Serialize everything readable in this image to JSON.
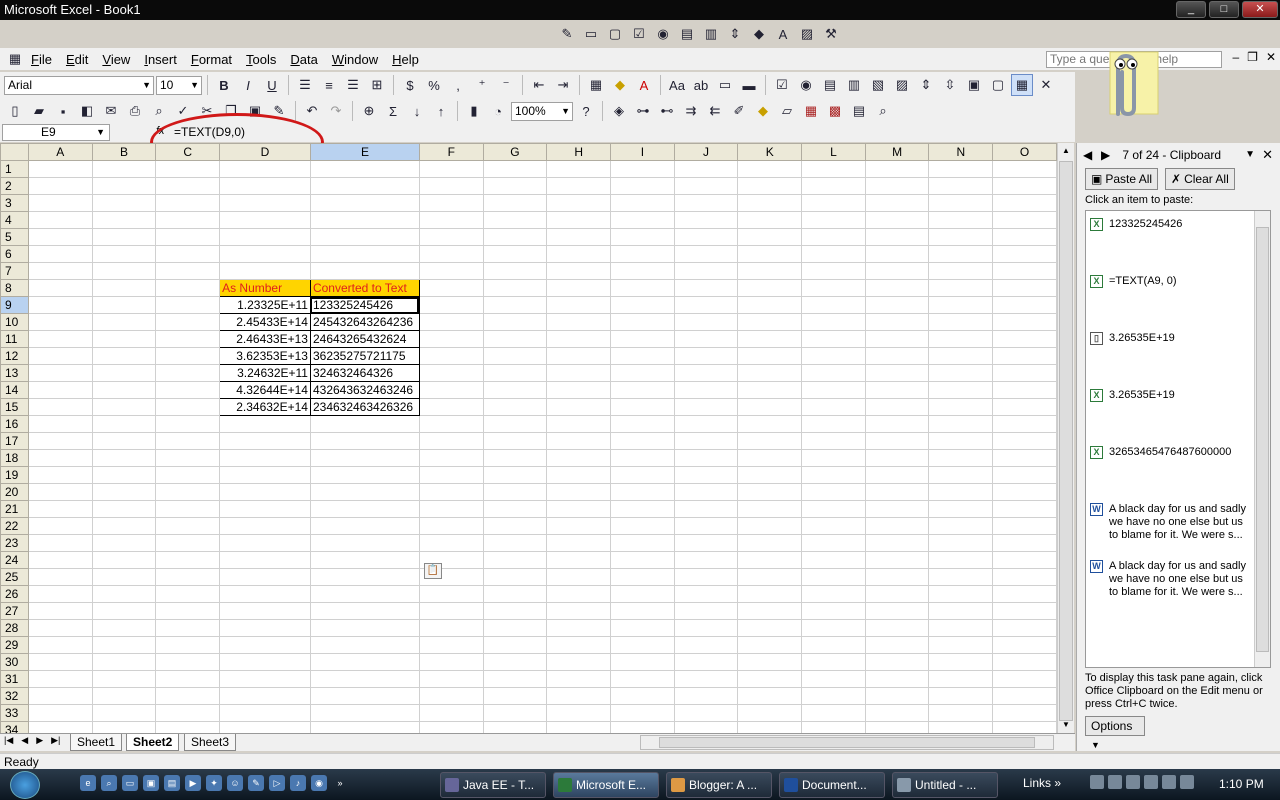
{
  "window": {
    "title": "Microsoft Excel - Book1",
    "min": "_",
    "max": "□",
    "close": "✕"
  },
  "menu": {
    "items": [
      {
        "key": "F",
        "rest": "ile"
      },
      {
        "key": "E",
        "rest": "dit"
      },
      {
        "key": "V",
        "rest": "iew"
      },
      {
        "key": "I",
        "rest": "nsert"
      },
      {
        "key": "F",
        "rest": "ormat"
      },
      {
        "key": "T",
        "rest": "ools"
      },
      {
        "key": "D",
        "rest": "ata"
      },
      {
        "key": "W",
        "rest": "indow"
      },
      {
        "key": "H",
        "rest": "elp"
      }
    ],
    "help_placeholder": "Type a question for help",
    "doc_min": "‒",
    "doc_restore": "❐",
    "doc_close": "✕"
  },
  "format_toolbar": {
    "font": "Arial",
    "size": "10",
    "bold": "B",
    "italic": "I",
    "underline": "U",
    "percent": "%",
    "comma": ","
  },
  "standard_toolbar": {
    "zoom": "100%",
    "sum": "Σ"
  },
  "formula_bar": {
    "name_box": "E9",
    "fx": "fx",
    "formula": "=TEXT(D9,0)"
  },
  "grid": {
    "columns": [
      "A",
      "B",
      "C",
      "D",
      "E",
      "F",
      "G",
      "H",
      "I",
      "J",
      "K",
      "L",
      "M",
      "N",
      "O"
    ],
    "selected_column": "E",
    "row_count": 34,
    "headers": [
      "As Number",
      "Converted to Text"
    ],
    "rows": [
      [
        "1.23325E+11",
        "123325245426"
      ],
      [
        "2.45433E+14",
        "245432643264236"
      ],
      [
        "2.46433E+13",
        "24643265432624"
      ],
      [
        "3.62353E+13",
        "36235275721175"
      ],
      [
        "3.24632E+11",
        "324632464326"
      ],
      [
        "4.32644E+14",
        "432643632463246"
      ],
      [
        "2.34632E+14",
        "234632463426326"
      ]
    ]
  },
  "sheets": {
    "tabs": [
      "Sheet1",
      "Sheet2",
      "Sheet3"
    ],
    "active": "Sheet2"
  },
  "status": {
    "text": "Ready"
  },
  "clipboard": {
    "title": "7 of 24 - Clipboard",
    "paste_all": "Paste All",
    "clear_all": "Clear All",
    "prompt": "Click an item to paste:",
    "items": [
      {
        "text": "123325245426",
        "icon": "excel-icon"
      },
      {
        "text": "=TEXT(A9, 0)",
        "icon": "excel-icon"
      },
      {
        "text": "3.26535E+19",
        "icon": "clipboard-icon"
      },
      {
        "text": "3.26535E+19",
        "icon": "excel-icon"
      },
      {
        "text": "32653465476487600000",
        "icon": "excel-icon"
      },
      {
        "text": "A black day for us and sadly we have no one else but us to blame for it. We were s...",
        "icon": "word-icon"
      },
      {
        "text": "A black day for us and sadly we have no one else but us to blame for it. We were s...",
        "icon": "word-icon"
      }
    ],
    "footer": "To display this task pane again, click Office Clipboard on the Edit menu or press Ctrl+C twice.",
    "options": "Options"
  },
  "taskbar": {
    "tasks": [
      "Java EE - T...",
      "Microsoft E...",
      "Blogger: A ...",
      "Document...",
      "Untitled - ..."
    ],
    "active_task": "Microsoft E...",
    "links": "Links",
    "clock": "1:10 PM"
  }
}
